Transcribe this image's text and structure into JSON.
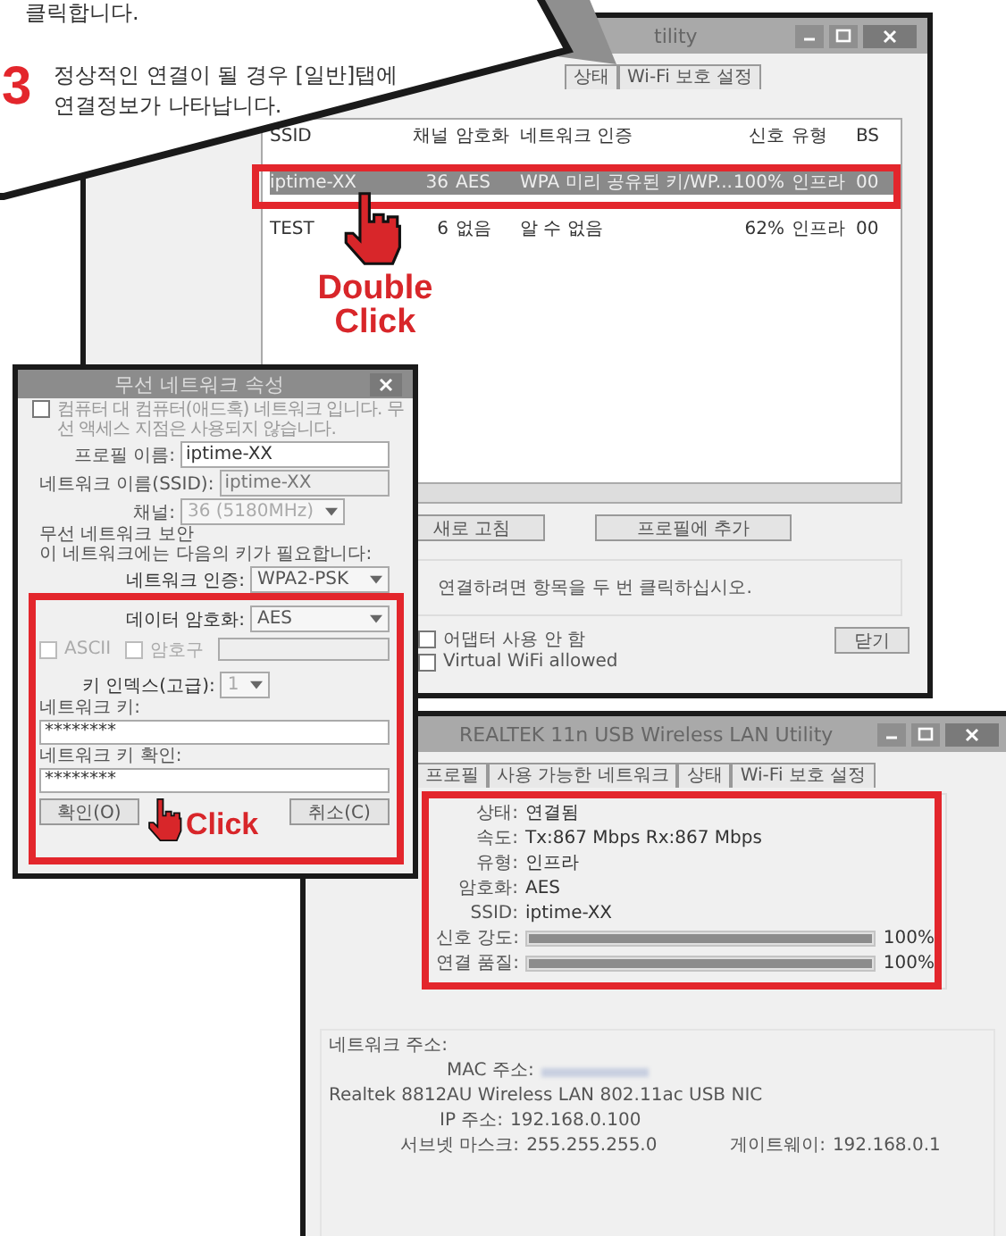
{
  "callout": {
    "prev_line": "클릭합니다.",
    "step": "3",
    "lines": [
      "정상적인 연결이 될 경우 [일반]탭에",
      "연결정보가 나타납니다."
    ]
  },
  "list_window": {
    "title": "tility",
    "tabs": [
      {
        "label": "상태"
      },
      {
        "label": "Wi-Fi 보호 설정"
      }
    ],
    "columns": [
      "SSID",
      "채널",
      "암호화",
      "네트워크 인증",
      "신호",
      "유형",
      "BS"
    ],
    "rows": [
      {
        "cells": [
          "iptime-XX",
          "36",
          "AES",
          "WPA 미리 공유된 키/WP...",
          "100%",
          "인프라",
          "00"
        ],
        "selected": true
      },
      {
        "cells": [
          "TEST",
          "6",
          "없음",
          "알 수 없음",
          "62%",
          "인프라",
          "00"
        ],
        "selected": false
      }
    ],
    "buttons": [
      "새로 고침",
      "프로필에 추가"
    ],
    "hint": "연결하려면 항목을 두 번 클릭하십시오.",
    "checks": [
      {
        "label": "어댑터 사용 안 함",
        "checked": false
      },
      {
        "label": "Virtual WiFi allowed",
        "checked": false
      }
    ],
    "close": "닫기"
  },
  "dialog": {
    "title": "무선 네트워크 속성",
    "adhoc": {
      "label": "컴퓨터 대 컴퓨터(애드혹) 네트워크 입니다. 무선 액세스 지점은 사용되지 않습니다.",
      "checked": false
    },
    "fields": [
      {
        "label": "프로필 이름:",
        "value": "iptime-XX",
        "disabled": false
      },
      {
        "label": "네트워크 이름(SSID):",
        "value": "iptime-XX",
        "disabled": true
      }
    ],
    "channel": {
      "label": "채널:",
      "value": "36 (5180MHz)"
    },
    "security_group": "무선 네트워크 보안",
    "security_note": "이 네트워크에는 다음의 키가 필요합니다:",
    "auth": {
      "label": "네트워크 인증:",
      "value": "WPA2-PSK"
    },
    "encryption": {
      "label": "데이터 암호화:",
      "value": "AES"
    },
    "options": [
      {
        "label": "ASCII",
        "checked": false,
        "disabled": true
      },
      {
        "label": "암호구",
        "checked": false,
        "disabled": true
      }
    ],
    "key_index": {
      "label": "키 인덱스(고급):",
      "value": "1"
    },
    "key": {
      "label": "네트워크 키:",
      "value": "********"
    },
    "key_confirm": {
      "label": "네트워크 키 확인:",
      "value": "********"
    },
    "buttons": [
      "확인(O)",
      "취소(C)"
    ]
  },
  "status_window": {
    "title": "REALTEK 11n USB Wireless LAN Utility",
    "tabs": [
      {
        "label": "프로필"
      },
      {
        "label": "사용 가능한 네트워크"
      },
      {
        "label": "상태"
      },
      {
        "label": "Wi-Fi 보호 설정"
      }
    ],
    "info": [
      {
        "label": "상태:",
        "value": "연결됨"
      },
      {
        "label": "속도:",
        "value": "Tx:867 Mbps Rx:867 Mbps"
      },
      {
        "label": "유형:",
        "value": "인프라"
      },
      {
        "label": "암호화:",
        "value": "AES"
      },
      {
        "label": "SSID:",
        "value": "iptime-XX"
      }
    ],
    "meters": [
      {
        "label": "신호 강도:",
        "level": 1,
        "reading": "100%"
      },
      {
        "label": "연결 품질:",
        "level": 1,
        "reading": "100%"
      }
    ],
    "address_group": "네트워크 주소:",
    "mac_label": "MAC 주소:",
    "adapter": "Realtek 8812AU Wireless LAN 802.11ac USB NIC",
    "ip": {
      "label": "IP 주소:",
      "value": "192.168.0.100"
    },
    "subnet": {
      "label": "서브넷 마스크:",
      "value": "255.255.255.0"
    },
    "gateway": {
      "label": "게이트웨이:",
      "value": "192.168.0.1"
    }
  },
  "annotations": [
    {
      "kind": "double",
      "text": "Double Click"
    },
    {
      "kind": "single",
      "text": "Click"
    }
  ]
}
